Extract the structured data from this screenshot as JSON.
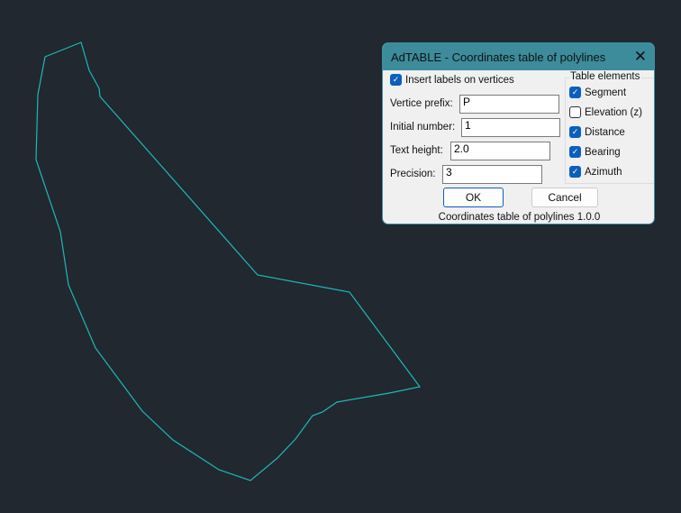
{
  "drawing": {
    "polyline_color": "#1fb8b8",
    "background": "#212830"
  },
  "dialog": {
    "title": "AdTABLE - Coordinates table of polylines",
    "insert_labels": {
      "label": "Insert labels on vertices",
      "checked": true
    },
    "fields": [
      {
        "label": "Vertice prefix:",
        "value": "P"
      },
      {
        "label": "Initial number:",
        "value": "1"
      },
      {
        "label": "Text height:",
        "value": "2.0"
      },
      {
        "label": "Precision:",
        "value": "3"
      }
    ],
    "table_elements": {
      "title": "Table elements",
      "items": [
        {
          "label": "Segment",
          "checked": true
        },
        {
          "label": "Elevation (z)",
          "checked": false
        },
        {
          "label": "Distance",
          "checked": true
        },
        {
          "label": "Bearing",
          "checked": true
        },
        {
          "label": "Azimuth",
          "checked": true
        }
      ]
    },
    "ok_label": "OK",
    "cancel_label": "Cancel",
    "footer": "Coordinates table of polylines 1.0.0"
  }
}
